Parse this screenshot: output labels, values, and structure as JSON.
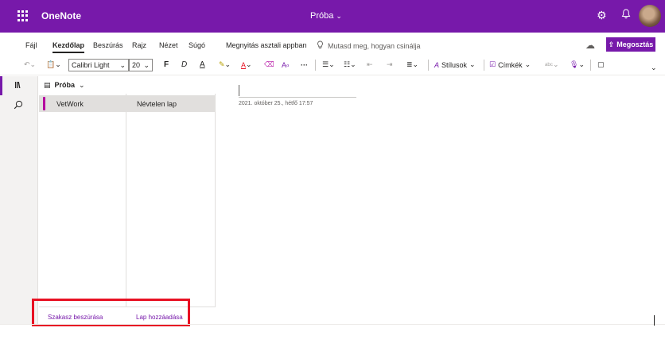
{
  "titlebar": {
    "app_name": "OneNote",
    "notebook_title": "Próba",
    "chevron": "⌵"
  },
  "menu": {
    "items": [
      "Fájl",
      "Kezdőlap",
      "Beszúrás",
      "Rajz",
      "Nézet",
      "Súgó"
    ],
    "active": "Kezdőlap",
    "open_desktop": "Megnyitás asztali appban",
    "tell_me": "Mutasd meg, hogyan csinálja",
    "share": "Megosztás"
  },
  "ribbon": {
    "font_name": "Calibri Light",
    "font_size": "20",
    "bold": "F",
    "italic": "D",
    "underline": "A",
    "more": "···",
    "styles": "Stílusok",
    "tags": "Címkék",
    "spell": "ᵃᵇᶜ"
  },
  "notebook": {
    "name": "Próba",
    "sections": [
      "VetWork"
    ],
    "pages": [
      "Névtelen lap"
    ],
    "add_section": "Szakasz beszúrása",
    "add_page": "Lap hozzáadása"
  },
  "page": {
    "date": "2021. október 25., hétfő   17:57"
  },
  "colors": {
    "brand": "#7719aa",
    "section_tab": "#b4009e",
    "highlight": "#e81123"
  },
  "icons": [
    "waffle-icon",
    "settings-icon",
    "bell-icon",
    "lightbulb-icon",
    "cloud-icon",
    "share-icon",
    "undo-icon",
    "paste-icon",
    "highlighter-icon",
    "font-color-icon",
    "eraser-icon",
    "bullets-icon",
    "numbering-icon",
    "outdent-icon",
    "indent-icon",
    "align-icon",
    "styles-icon",
    "tag-icon",
    "dictate-icon",
    "immersive-reader-icon",
    "notebooks-icon",
    "search-icon",
    "notebook-icon"
  ]
}
